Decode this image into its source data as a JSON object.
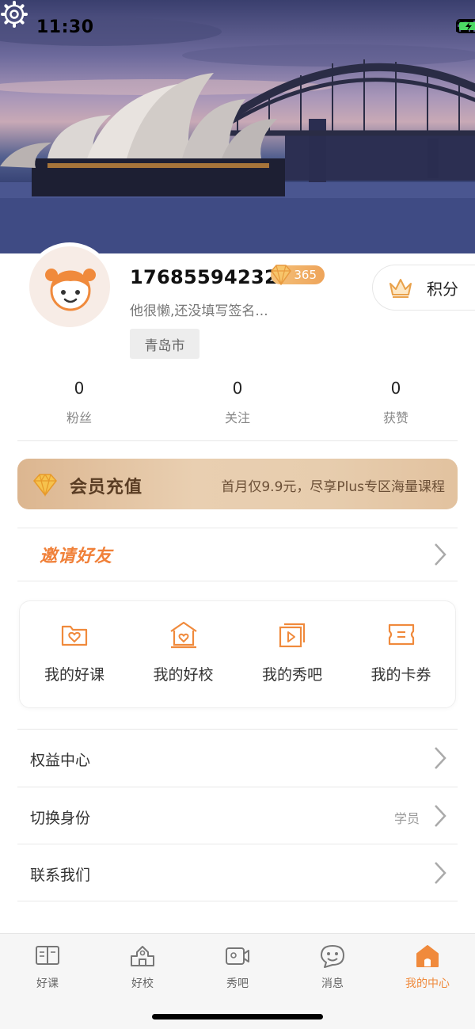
{
  "status_bar": {
    "time": "11:30"
  },
  "profile": {
    "phone": "17685594232",
    "vip_level": "365",
    "signature": "他很懒,还没填写签名...",
    "city": "青岛市",
    "points_label": "积分"
  },
  "stats": [
    {
      "value": "0",
      "label": "粉丝"
    },
    {
      "value": "0",
      "label": "关注"
    },
    {
      "value": "0",
      "label": "获赞"
    }
  ],
  "member": {
    "title": "会员充值",
    "desc": "首月仅9.9元，尽享Plus专区海量课程"
  },
  "invite": {
    "label": "邀请好友"
  },
  "quick_links": [
    {
      "label": "我的好课",
      "icon": "folder-heart-icon"
    },
    {
      "label": "我的好校",
      "icon": "school-heart-icon"
    },
    {
      "label": "我的秀吧",
      "icon": "video-play-icon"
    },
    {
      "label": "我的卡券",
      "icon": "coupon-icon"
    }
  ],
  "menu": [
    {
      "label": "权益中心",
      "value": ""
    },
    {
      "label": "切换身份",
      "value": "学员"
    },
    {
      "label": "联系我们",
      "value": ""
    }
  ],
  "tabs": [
    {
      "label": "好课",
      "icon": "book-icon"
    },
    {
      "label": "好校",
      "icon": "school-icon"
    },
    {
      "label": "秀吧",
      "icon": "video-icon"
    },
    {
      "label": "消息",
      "icon": "message-icon"
    },
    {
      "label": "我的中心",
      "icon": "home-icon",
      "active": true
    }
  ],
  "colors": {
    "accent": "#f08a3c",
    "member_bg": "#e5c6a4",
    "member_text": "#5a3d24"
  }
}
